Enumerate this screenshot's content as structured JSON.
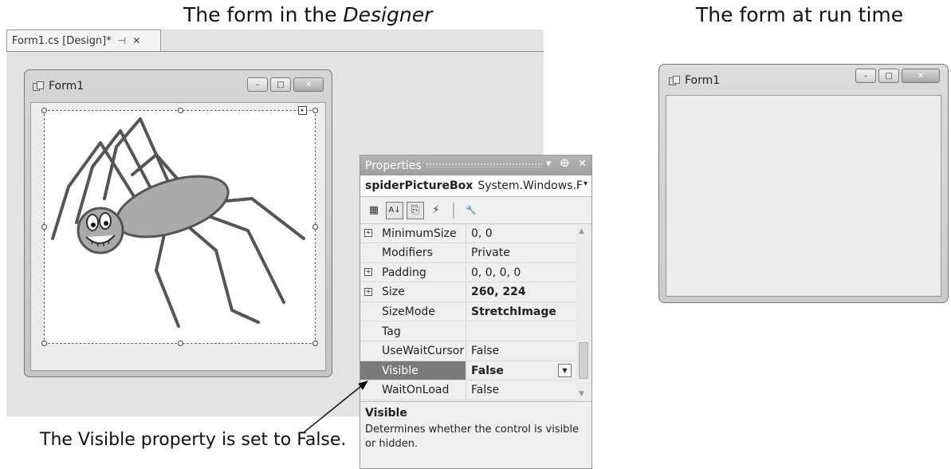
{
  "captions": {
    "designer_prefix": "The form in the ",
    "designer_italic": "Designer",
    "runtime": "The form at run time",
    "annotation": "The Visible property is set to False."
  },
  "designer": {
    "tab_label": "Form1.cs [Design]*",
    "tab_pin": "⊣",
    "tab_close": "✕",
    "form_title": "Form1",
    "caption_buttons": {
      "minimize": "–",
      "maximize": "□",
      "close": "✕"
    }
  },
  "properties": {
    "title": "Properties",
    "title_buttons": {
      "dropdown": "▾",
      "pin": "ⴲ",
      "close": "✕"
    },
    "object_name": "spiderPictureBox",
    "object_type": "System.Windows.F",
    "toolbar": {
      "categorized": "▦",
      "alphabetical": "A↓",
      "properties": "⎘",
      "events": "⚡",
      "pages": "🔧"
    },
    "rows": [
      {
        "name": "MinimumSize",
        "value": "0, 0",
        "expandable": true,
        "bold": false
      },
      {
        "name": "Modifiers",
        "value": "Private",
        "expandable": false,
        "bold": false
      },
      {
        "name": "Padding",
        "value": "0, 0, 0, 0",
        "expandable": true,
        "bold": false
      },
      {
        "name": "Size",
        "value": "260, 224",
        "expandable": true,
        "bold": true
      },
      {
        "name": "SizeMode",
        "value": "StretchImage",
        "expandable": false,
        "bold": true
      },
      {
        "name": "Tag",
        "value": "",
        "expandable": false,
        "bold": false
      },
      {
        "name": "UseWaitCursor",
        "value": "False",
        "expandable": false,
        "bold": false
      },
      {
        "name": "Visible",
        "value": "False",
        "expandable": false,
        "bold": true,
        "selected": true
      },
      {
        "name": "WaitOnLoad",
        "value": "False",
        "expandable": false,
        "bold": false
      }
    ],
    "description_title": "Visible",
    "description_text": "Determines whether the control is visible or hidden."
  },
  "runtime": {
    "form_title": "Form1",
    "caption_buttons": {
      "minimize": "–",
      "maximize": "□",
      "close": "✕"
    }
  },
  "colors": {
    "selected_row": "#7a7a7a",
    "title_bar": "#a8a8a8"
  }
}
